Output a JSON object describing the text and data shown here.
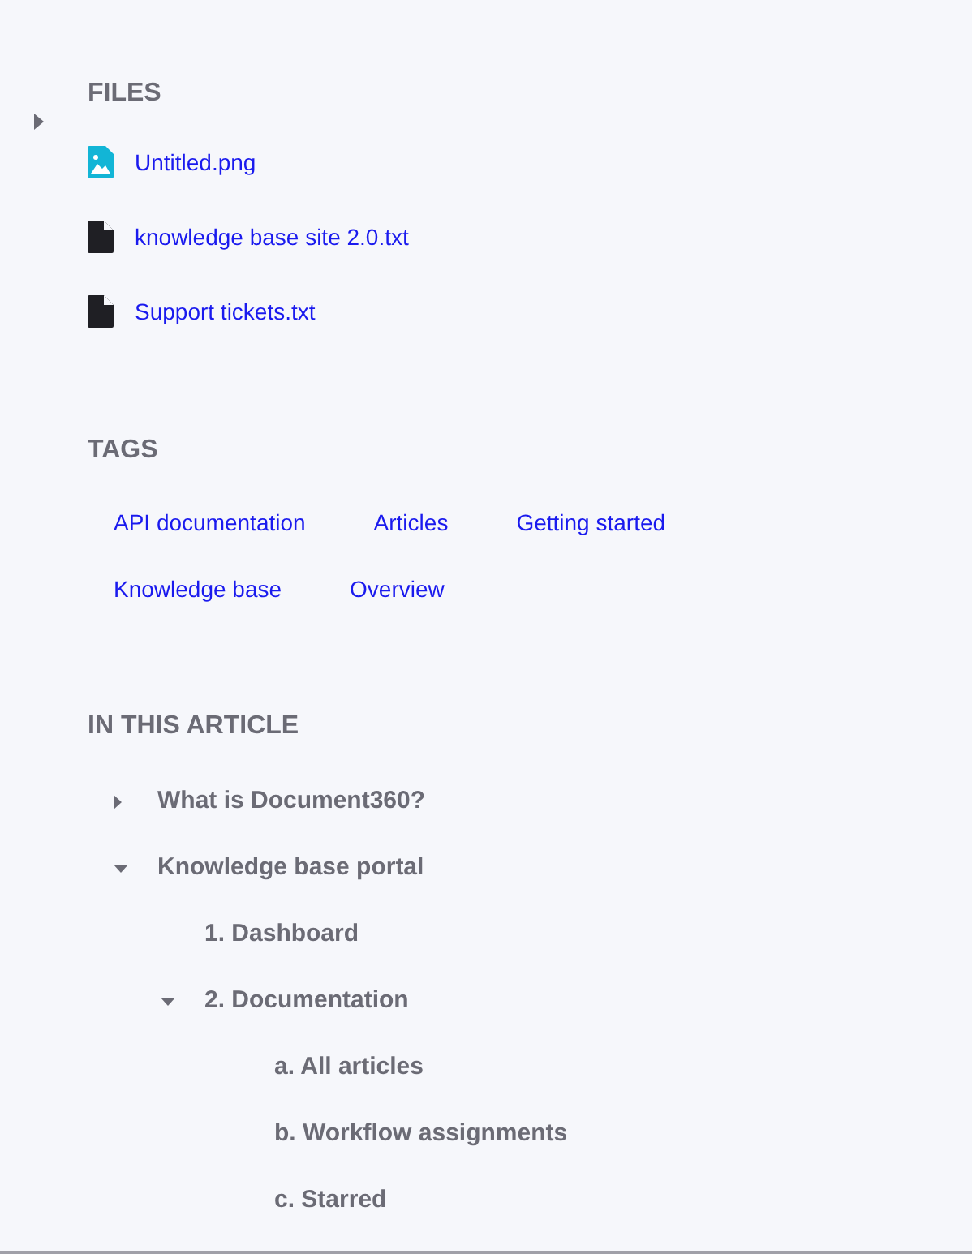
{
  "files": {
    "title": "FILES",
    "items": [
      {
        "name": "Untitled.png",
        "kind": "image"
      },
      {
        "name": "knowledge base site 2.0.txt",
        "kind": "text"
      },
      {
        "name": "Support tickets.txt",
        "kind": "text"
      }
    ]
  },
  "tags": {
    "title": "TAGS",
    "items": [
      "API documentation",
      "Articles",
      "Getting started",
      "Knowledge base",
      "Overview"
    ]
  },
  "toc": {
    "title": "IN THIS ARTICLE",
    "items": [
      {
        "label": "What is Document360?",
        "expanded": false
      },
      {
        "label": "Knowledge base portal",
        "expanded": true,
        "children": [
          {
            "label": "1. Dashboard"
          },
          {
            "label": "2. Documentation",
            "expanded": true,
            "children": [
              {
                "label": "a. All articles"
              },
              {
                "label": "b. Workflow assignments"
              },
              {
                "label": "c. Starred"
              }
            ]
          }
        ]
      }
    ]
  }
}
